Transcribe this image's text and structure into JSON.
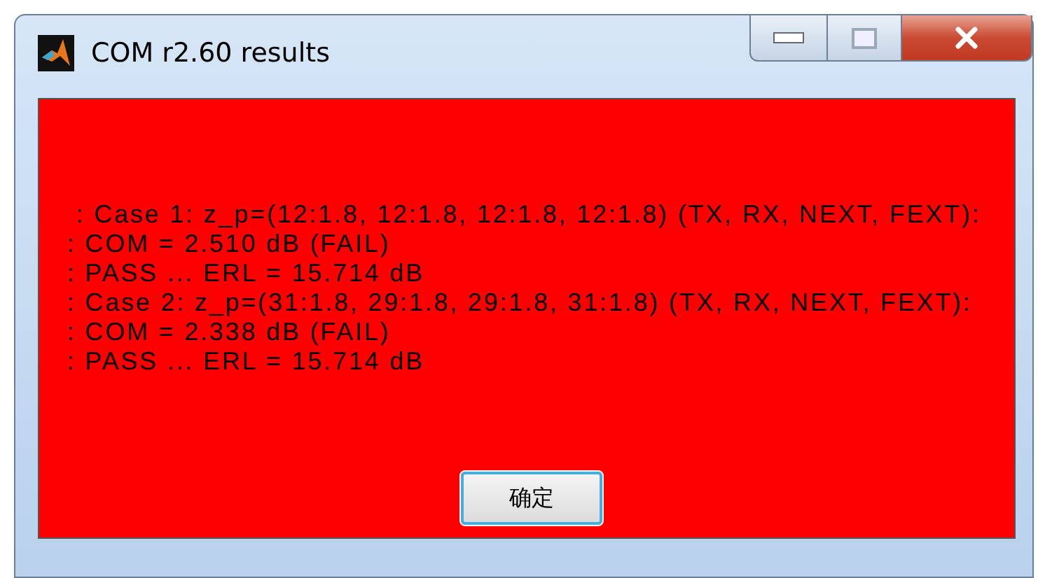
{
  "window": {
    "title": "COM r2.60 results"
  },
  "message": {
    "lines": [
      " : Case 1: z_p=(12:1.8, 12:1.8, 12:1.8, 12:1.8) (TX, RX, NEXT, FEXT):",
      ": COM = 2.510 dB (FAIL)",
      ": PASS ... ERL = 15.714 dB",
      ": Case 2: z_p=(31:1.8, 29:1.8, 29:1.8, 31:1.8) (TX, RX, NEXT, FEXT):",
      ": COM = 2.338 dB (FAIL)",
      ": PASS ... ERL = 15.714 dB"
    ]
  },
  "buttons": [
    "确定"
  ]
}
